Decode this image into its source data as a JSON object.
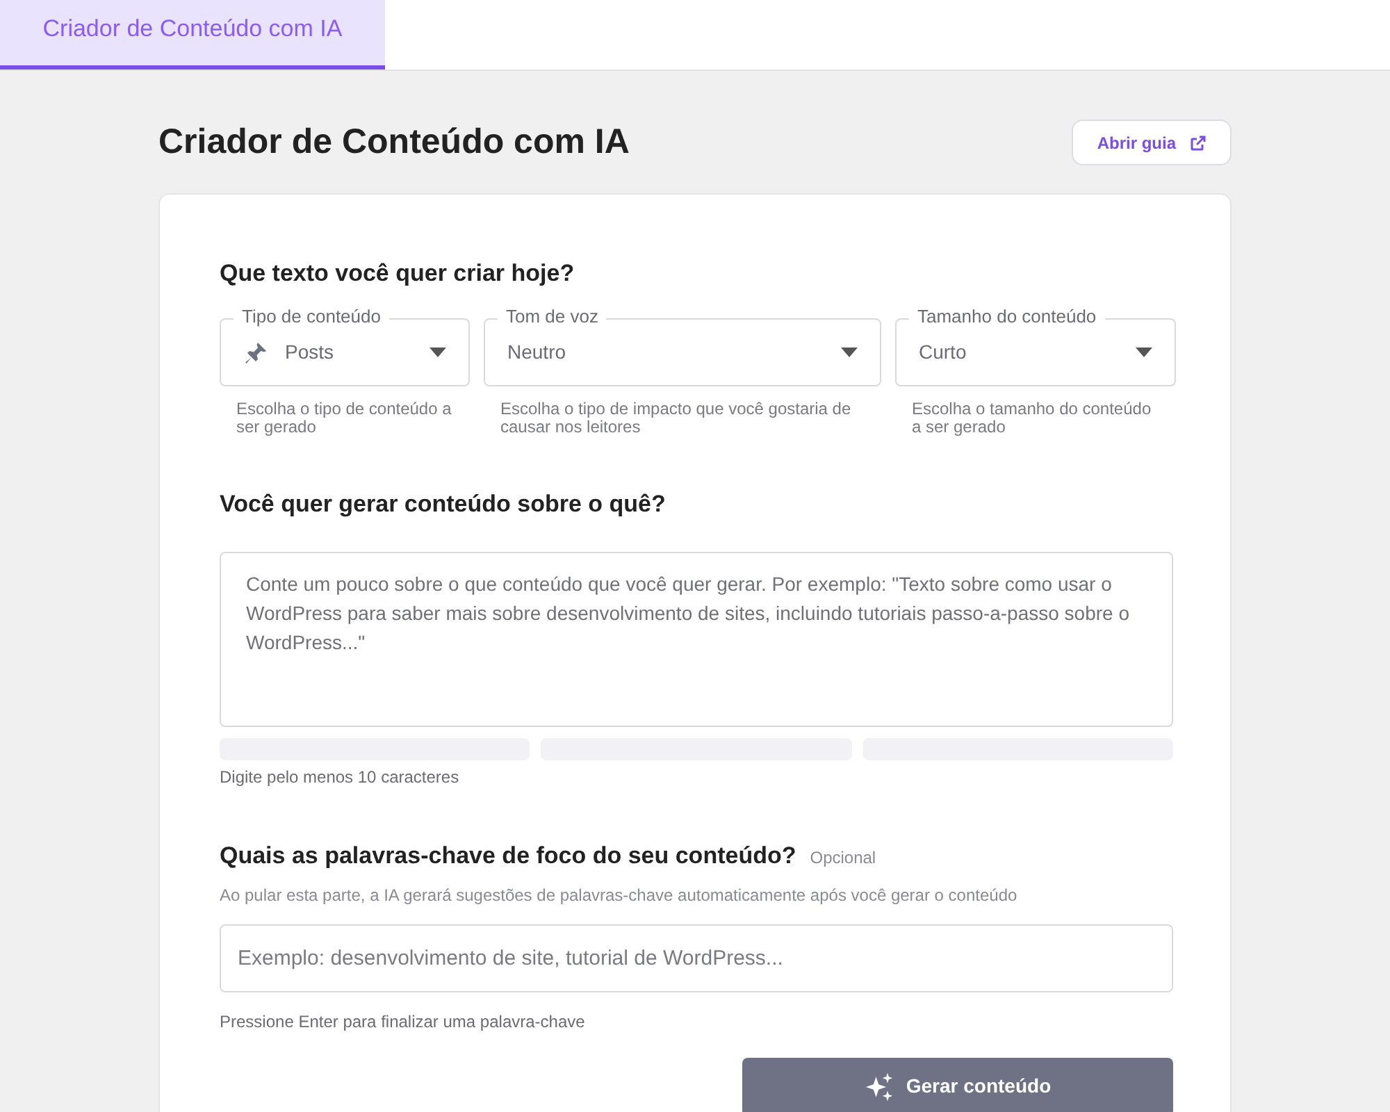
{
  "tabs": [
    {
      "label": "Criador de Conteúdo com IA",
      "selected": true
    }
  ],
  "page": {
    "title": "Criador de Conteúdo com IA",
    "guide_button": "Abrir guia"
  },
  "form": {
    "section_1": {
      "heading": "Que texto você quer criar hoje?",
      "selects": [
        {
          "label": "Tipo de conteúdo",
          "value": "Posts",
          "kind": "with_icon",
          "hint": "Escolha o tipo de conteúdo a ser gerado"
        },
        {
          "label": "Tom de voz",
          "value": "Neutro",
          "kind": "plain",
          "hint": "Escolha o tipo de impacto que você gostaria de causar nos leitores"
        },
        {
          "label": "Tamanho do conteúdo",
          "value": "Curto",
          "kind": "plain",
          "hint": "Escolha o tamanho do conteúdo a ser gerado"
        }
      ]
    },
    "section_2": {
      "heading": "Você quer gerar conteúdo sobre o quê?",
      "placeholder": "Conte um pouco sobre o que conteúdo que você quer gerar. Por exemplo: \"Texto sobre como usar o WordPress para saber mais sobre desenvolvimento de sites, incluindo tutoriais passo-a-passo sobre o WordPress...\"",
      "meter": [
        {
          "on": false
        },
        {
          "on": false
        },
        {
          "on": false
        }
      ],
      "hint": "Digite pelo menos 10 caracteres"
    },
    "section_3": {
      "heading": "Quais as palavras-chave de foco do seu conteúdo?",
      "badge": "Opcional",
      "description": "Ao pular esta parte, a IA gerará sugestões de palavras-chave automaticamente após você gerar o conteúdo",
      "placeholder": "Exemplo: desenvolvimento de site, tutorial de WordPress...",
      "hint": "Pressione Enter para finalizar uma palavra-chave"
    },
    "submit": {
      "label": "Gerar conteúdo",
      "disabled": true
    }
  }
}
